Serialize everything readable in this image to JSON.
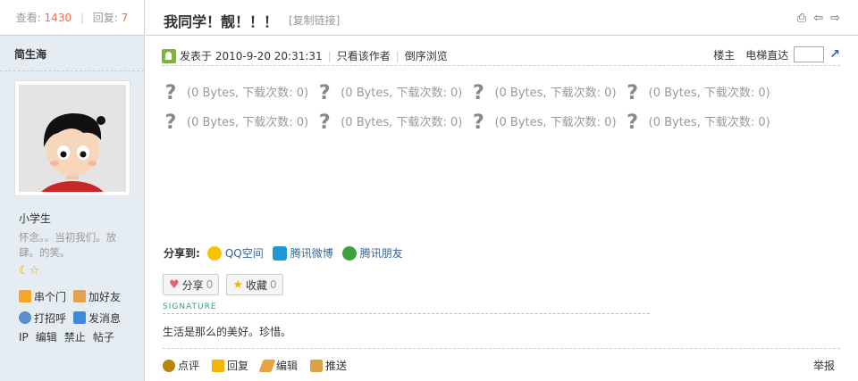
{
  "stats": {
    "views_label": "查看:",
    "views": "1430",
    "separator": "|",
    "replies_label": "回复:",
    "replies": "7"
  },
  "author": {
    "name": "简生海",
    "rank_title": "小学生",
    "user_text": "怀念。。当初我们。放肆。的笑。",
    "actions": {
      "homepage": "串个门",
      "add_friend": "加好友",
      "poke": "打招呼",
      "message": "发消息"
    },
    "links": [
      "IP",
      "编辑",
      "禁止",
      "帖子"
    ]
  },
  "thread": {
    "title": "我同学！靓！！！",
    "copy_link": "[复制链接]"
  },
  "post": {
    "posted_prefix": "发表于",
    "posted_time": "2010-9-20 20:31:31",
    "divider": "|",
    "only_author": "只看该作者",
    "reverse": "倒序浏览",
    "floor": "楼主",
    "goto_label": "电梯直达"
  },
  "attachments": [
    {
      "icon": "?",
      "info": "(0 Bytes, 下载次数: 0)"
    },
    {
      "icon": "?",
      "info": "(0 Bytes, 下载次数: 0)"
    },
    {
      "icon": "?",
      "info": "(0 Bytes, 下载次数: 0)"
    },
    {
      "icon": "?",
      "info": "(0 Bytes, 下载次数: 0)"
    },
    {
      "icon": "?",
      "info": "(0 Bytes, 下载次数: 0)"
    },
    {
      "icon": "?",
      "info": "(0 Bytes, 下载次数: 0)"
    },
    {
      "icon": "?",
      "info": "(0 Bytes, 下载次数: 0)"
    },
    {
      "icon": "?",
      "info": "(0 Bytes, 下载次数: 0)"
    }
  ],
  "share": {
    "label": "分享到:",
    "qzone": "QQ空间",
    "weibo": "腾讯微博",
    "pengyou": "腾讯朋友"
  },
  "buttons": {
    "share_label": "分享",
    "share_count": "0",
    "fav_label": "收藏",
    "fav_count": "0"
  },
  "signature": {
    "label": "SIGNATURE",
    "text": "生活是那么的美好。珍惜。"
  },
  "bottom": {
    "comment": "点评",
    "reply": "回复",
    "edit": "编辑",
    "push": "推送",
    "report": "举报"
  },
  "colors": {
    "sidebar_bg": "#E5EDF2",
    "border": "#C2D5E3",
    "accent_number": "#F26C4F",
    "link": "#336699"
  }
}
